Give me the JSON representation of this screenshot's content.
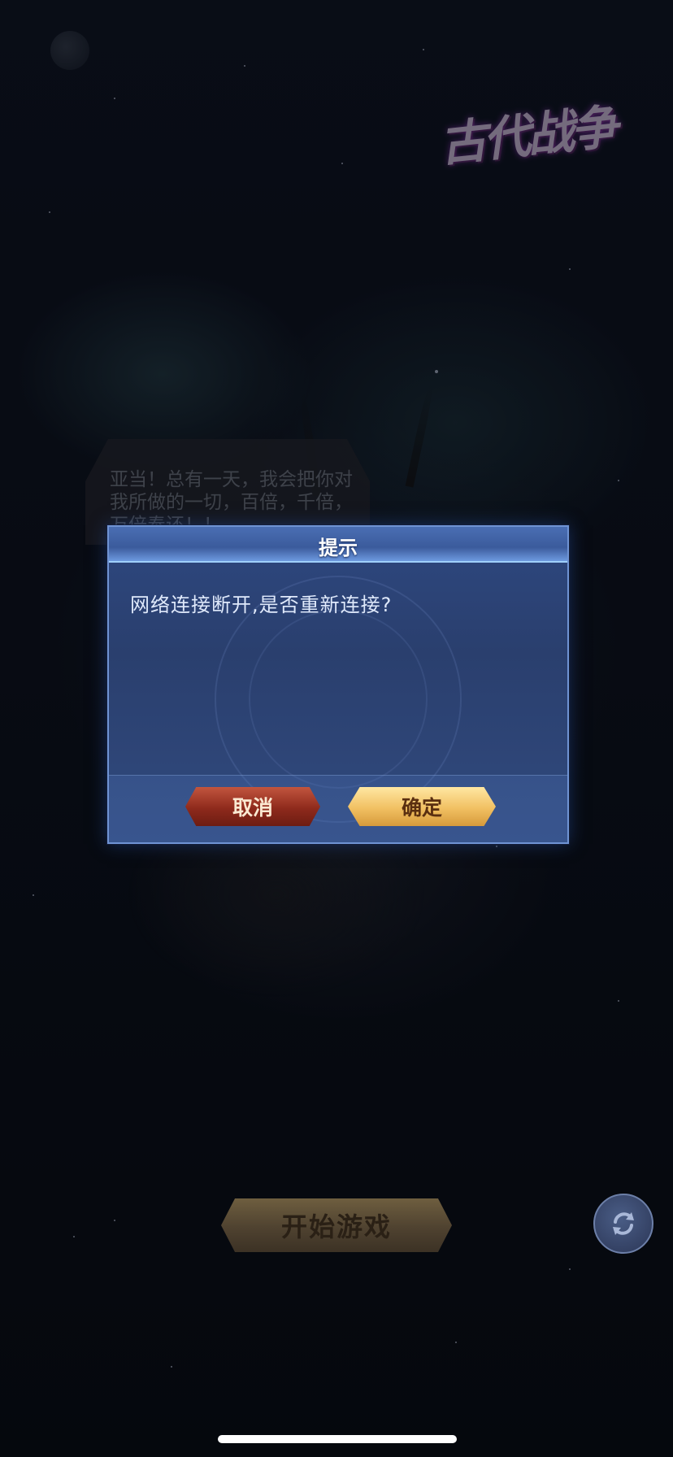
{
  "game": {
    "logo_text": "古代战争"
  },
  "story": {
    "speech_text": "亚当！总有一天，我会把你对我所做的一切，百倍，千倍，万倍奉还！！"
  },
  "dialog": {
    "title": "提示",
    "message": "网络连接断开,是否重新连接?",
    "cancel_label": "取消",
    "confirm_label": "确定"
  },
  "main": {
    "start_label": "开始游戏",
    "refresh_icon": "refresh-icon"
  },
  "colors": {
    "dialog_border": "#6f93d3",
    "cancel_button": "#8e2a1c",
    "confirm_button": "#f1c062"
  }
}
